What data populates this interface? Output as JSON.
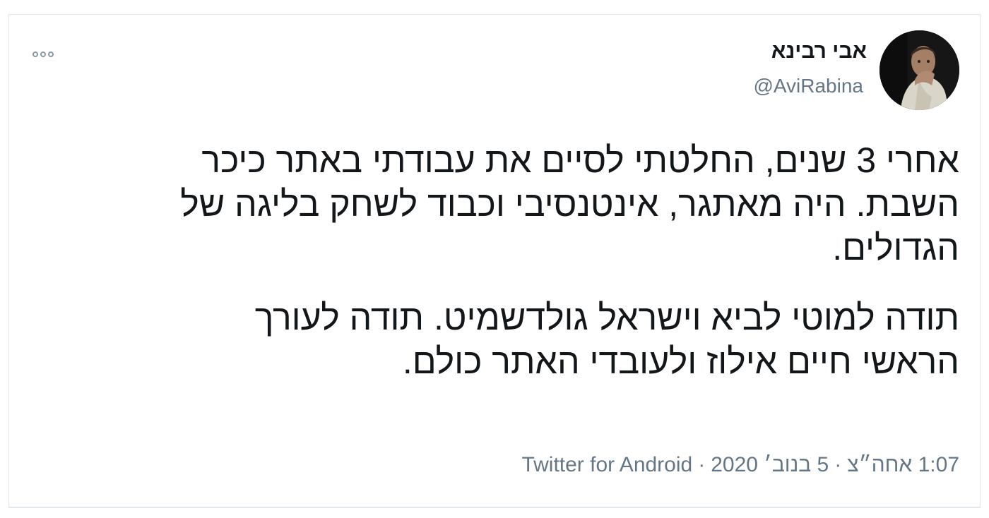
{
  "tweet": {
    "author": {
      "display_name": "אבי רבינא",
      "handle": "@AviRabina",
      "avatar_icon": "profile-photo"
    },
    "more_icon": "more-options-icon",
    "text_lines": [
      "אחרי 3 שנים, החלטתי לסיים את עבודתי באתר כיכר",
      "השבת. היה מאתגר, אינטנסיבי וכבוד לשחק בליגה של",
      "הגדולים.",
      "תודה למוטי לביא וישראל גולדשמיט. תודה לעורך",
      "הראשי חיים אילוז ולעובדי האתר כולם."
    ],
    "meta": {
      "time": "1:07 אחה״צ",
      "separator": "·",
      "date": "5 בנוב׳ 2020",
      "source": "Twitter for Android"
    }
  },
  "colors": {
    "text_primary": "#14171a",
    "text_secondary": "#657786",
    "border": "#e3e7ea"
  }
}
